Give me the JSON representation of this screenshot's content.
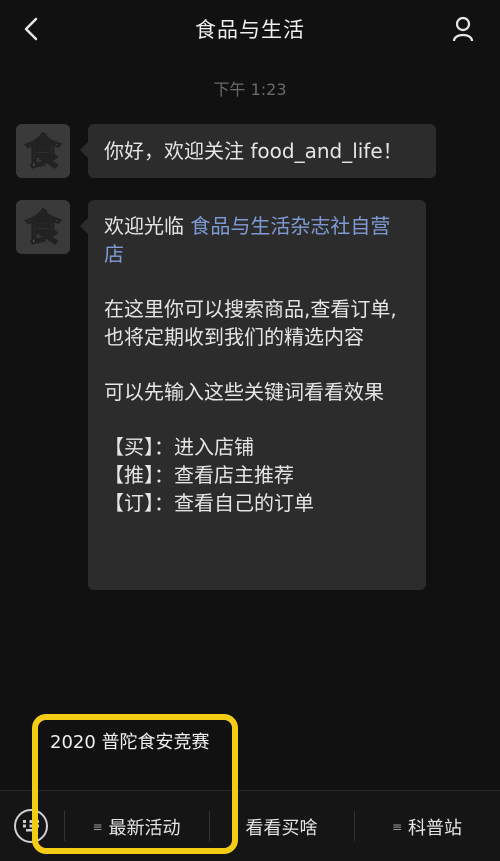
{
  "header": {
    "title": "食品与生活",
    "back_icon": "chevron-left-icon",
    "profile_icon": "person-icon"
  },
  "timestamp": "下午 1:23",
  "messages": [
    {
      "avatar_text": "食",
      "lines": [
        "你好，欢迎关注 food_and_life！"
      ]
    },
    {
      "avatar_text": "食",
      "intro": "欢迎光临 ",
      "link": "食品与生活杂志社自营店",
      "para2": "在这里你可以搜索商品,查看订单,也将定期收到我们的精选内容",
      "para3": "可以先输入这些关键词看看效果",
      "commands": [
        "【买】：进入店铺",
        "【推】：查看店主推荐",
        "【订】：查看自己的订单"
      ]
    }
  ],
  "quick_reply": "2020 普陀食安竞赛",
  "menu": {
    "keyboard_icon": "keyboard-icon",
    "items": [
      "最新活动",
      "看看买啥",
      "科普站"
    ]
  },
  "colors": {
    "background": "#111111",
    "bubble": "#2c2c2c",
    "link": "#7f9bd6",
    "highlight": "#f3cd14"
  }
}
